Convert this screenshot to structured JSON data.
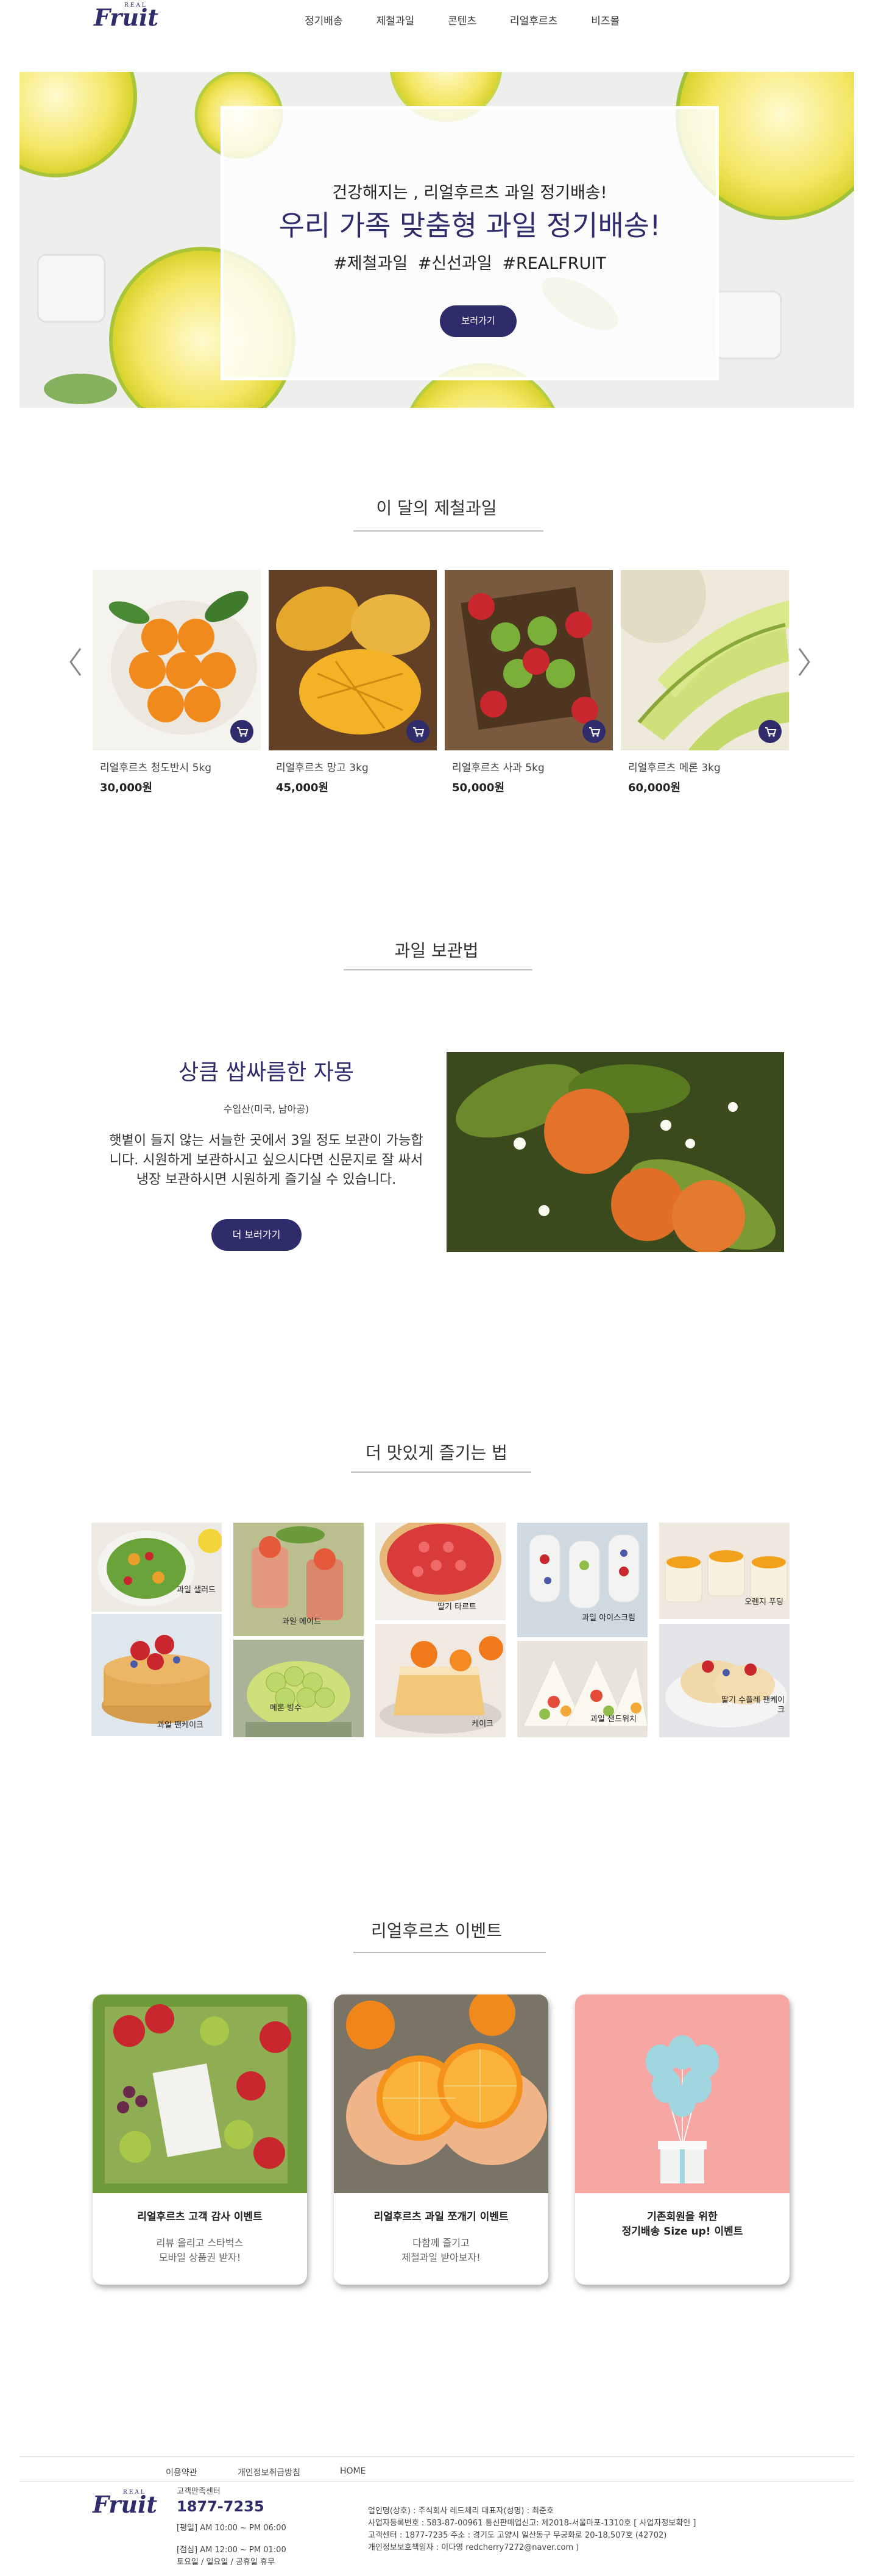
{
  "header": {
    "logo_top": "REAL",
    "logo_word": "Fruit",
    "nav": [
      "정기배송",
      "제철과일",
      "콘텐츠",
      "리얼후르츠",
      "비즈몰"
    ]
  },
  "hero": {
    "subtitle": "건강해지는 , 리얼후르츠 과일 정기배송!",
    "title": "우리 가족 맞춤형 과일 정기배송!",
    "tags": "#제철과일    #신선과일    #REALFRUIT",
    "button": "보러가기"
  },
  "seasonal": {
    "title": "이 달의 제철과일",
    "products": [
      {
        "name": "리얼후르츠 청도반시 5kg",
        "price": "30,000원"
      },
      {
        "name": "리얼후르츠 망고 3kg",
        "price": "45,000원"
      },
      {
        "name": "리얼후르츠 사과 5kg",
        "price": "50,000원"
      },
      {
        "name": "리얼후르츠 메론 3kg",
        "price": "60,000원"
      }
    ]
  },
  "storage": {
    "section_title": "과일 보관법",
    "title": "상큼 쌉싸름한 자몽",
    "origin": "수입산(미국, 남아공)",
    "desc_lines": [
      "햇볕이 들지 않는 서늘한 곳에서 3일 정도 보관이 가능합",
      "니다. 시원하게 보관하시고 싶으시다면 신문지로 잘 싸서",
      "냉장 보관하시면 시원하게 즐기실 수 있습니다."
    ],
    "button": "더 보러가기"
  },
  "recipes": {
    "title": "더 맛있게 즐기는 법",
    "items": [
      "과일 샐러드",
      "과일 에이드",
      "딸기 타르트",
      "과일 아이스크림",
      "오렌지 푸딩",
      "과일 팬케이크",
      "메론 빙수",
      "케이크",
      "과일 샌드위치",
      "딸기 수플레 팬케이크"
    ]
  },
  "events": {
    "title": "리얼후르츠 이벤트",
    "items": [
      {
        "title": "리얼후르츠 고객 감사 이벤트",
        "desc1": "리뷰 올리고 스타벅스",
        "desc2": "모바일 상품권 받자!"
      },
      {
        "title": "리얼후르츠 과일 쪼개기 이벤트",
        "desc1": "다함께 즐기고",
        "desc2": "제철과일 받아보자!"
      },
      {
        "title": "기존회원을 위한",
        "title2": "정기배송 Size up! 이벤트",
        "desc1": "",
        "desc2": ""
      }
    ]
  },
  "footer": {
    "links": [
      "이용약관",
      "개인정보취급방침",
      "HOME"
    ],
    "cs_label": "고객만족센터",
    "phone": "1877-7235",
    "hours1": "[평일] AM 10:00 ~ PM 06:00",
    "hours2": "[점심] AM 12:00 ~ PM 01:00",
    "hours3": "토요일 / 일요일 / 공휴일 휴무",
    "company1": "업인명(상호) : 주식회사 레드체리      대표자(성명) : 최준호",
    "company2": "사업자등록번호 : 583-87-00961      통신판매업신고: 제2018-서울마포-1310호 [ 사업자정보확인 ]",
    "company3": "고객센터 : 1877-7235      주소 : 경기도 고양시 일산동구 무궁화로 20-18,507호 (42702)",
    "company4": "개인정보보호책임자 : 이다영 redcherry7272@naver.com )"
  }
}
